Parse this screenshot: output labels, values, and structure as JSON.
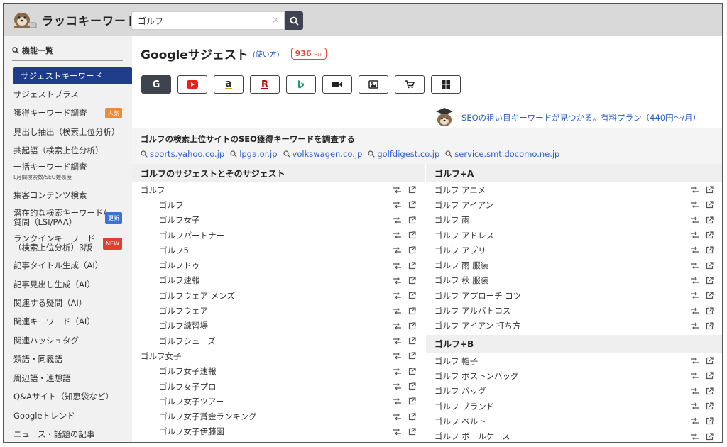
{
  "app": {
    "name": "ラッコキーワード"
  },
  "search": {
    "value": "ゴルフ",
    "clear": "×"
  },
  "sidebar": {
    "header": "機能一覧",
    "items": [
      {
        "label": "サジェストキーワード",
        "active": true
      },
      {
        "label": "サジェストプラス"
      },
      {
        "label": "獲得キーワード調査",
        "badge": "人気"
      },
      {
        "label": "見出し抽出（検索上位分析）"
      },
      {
        "label": "共起語（検索上位分析）"
      },
      {
        "label": "一括キーワード調査",
        "sub": "L月間検索数/SEO難易度"
      },
      {
        "label": "集客コンテンツ検索"
      },
      {
        "label": "潜在的な検索キーワード/",
        "label2": "質問（LSI/PAA）",
        "badge": "更新"
      },
      {
        "label": "ランクインキーワード",
        "label2": "（検索上位分析）β版",
        "badge": "NEW"
      },
      {
        "label": "記事タイトル生成（AI）"
      },
      {
        "label": "記事見出し生成（AI）"
      },
      {
        "label": "関連する疑問（AI）"
      },
      {
        "label": "関連キーワード（AI）"
      },
      {
        "label": "関連ハッシュタグ"
      },
      {
        "label": "類語・同義語"
      },
      {
        "label": "周辺語・連想語"
      },
      {
        "label": "Q&Aサイト（知恵袋など）"
      },
      {
        "label": "Googleトレンド"
      },
      {
        "label": "ニュース・話題の記事"
      }
    ]
  },
  "main": {
    "title": "Googleサジェスト",
    "howto": "(使い方)",
    "hit_count": "936",
    "hit_unit": "HIT",
    "engines": [
      "G",
      "youtube",
      "a",
      "R",
      "b",
      "video",
      "image",
      "cart",
      "windows"
    ],
    "promo": "SEOの狙い目キーワードが見つかる。有料プラン（440円〜/月）",
    "seo_title": "ゴルフの検索上位サイトのSEO獲得キーワードを調査する",
    "seo_links": [
      "sports.yahoo.co.jp",
      "lpga.or.jp",
      "volkswagen.co.jp",
      "golfdigest.co.jp",
      "service.smt.docomo.ne.jp"
    ],
    "left_header": "ゴルフのサジェストとそのサジェスト",
    "left_rows": [
      {
        "text": "ゴルフ",
        "sub": false
      },
      {
        "text": "ゴルフ",
        "sub": true
      },
      {
        "text": "ゴルフ女子",
        "sub": true
      },
      {
        "text": "ゴルフパートナー",
        "sub": true
      },
      {
        "text": "ゴルフ5",
        "sub": true
      },
      {
        "text": "ゴルフドゥ",
        "sub": true
      },
      {
        "text": "ゴルフ速報",
        "sub": true
      },
      {
        "text": "ゴルフウェア メンズ",
        "sub": true
      },
      {
        "text": "ゴルフウェア",
        "sub": true
      },
      {
        "text": "ゴルフ練習場",
        "sub": true
      },
      {
        "text": "ゴルフシューズ",
        "sub": true
      },
      {
        "text": "ゴルフ女子",
        "sub": false
      },
      {
        "text": "ゴルフ女子速報",
        "sub": true
      },
      {
        "text": "ゴルフ女子プロ",
        "sub": true
      },
      {
        "text": "ゴルフ女子ツアー",
        "sub": true
      },
      {
        "text": "ゴルフ女子賞金ランキング",
        "sub": true
      },
      {
        "text": "ゴルフ女子伊藤園",
        "sub": true
      }
    ],
    "right_header_a": "ゴルフ+A",
    "right_rows_a": [
      "ゴルフ アニメ",
      "ゴルフ アイアン",
      "ゴルフ 雨",
      "ゴルフ アドレス",
      "ゴルフ アプリ",
      "ゴルフ 雨 服装",
      "ゴルフ 秋 服装",
      "ゴルフ アプローチ コツ",
      "ゴルフ アルバトロス",
      "ゴルフ アイアン 打ち方"
    ],
    "right_header_b": "ゴルフ+B",
    "right_rows_b": [
      "ゴルフ 帽子",
      "ゴルフ ボストンバッグ",
      "ゴルフ バッグ",
      "ゴルフ ブランド",
      "ゴルフ ベルト",
      "ゴルフ ボールケース"
    ]
  },
  "icons": {
    "search": "search-icon",
    "swap": "swap-icon",
    "external": "external-link-icon"
  },
  "colors": {
    "accent": "#1f3c8a",
    "link": "#2b5fc7",
    "hit": "#e24b3b"
  }
}
